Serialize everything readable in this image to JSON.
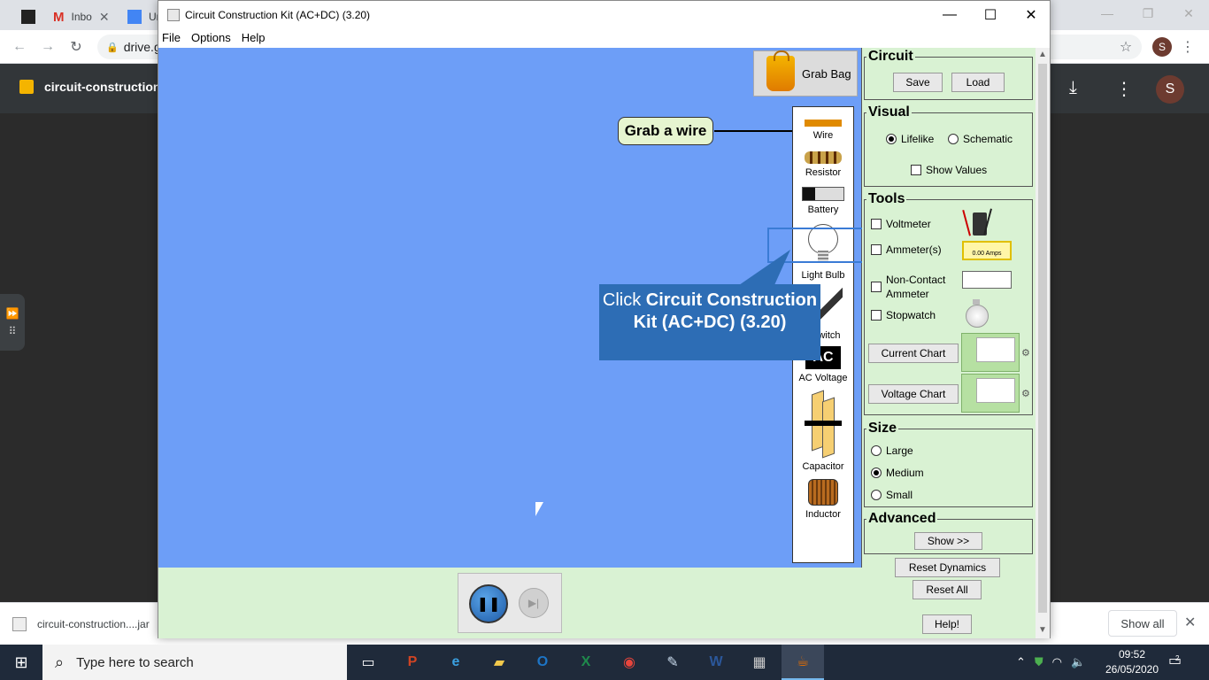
{
  "chrome": {
    "tabs": [
      {
        "label": "",
        "icon": "phet-icon"
      },
      {
        "label": "Inbo",
        "icon": "gmail-icon"
      },
      {
        "label": "Ur",
        "icon": "docs-icon"
      }
    ],
    "url": "drive.g",
    "profile_initial": "S",
    "drive_file_title": "circuit-construction",
    "drive_avatar": "S",
    "download_item": "circuit-construction....jar",
    "show_all": "Show all"
  },
  "app": {
    "title": "Circuit Construction Kit (AC+DC) (3.20)",
    "menu": [
      "File",
      "Options",
      "Help"
    ],
    "grab_bag": "Grab Bag",
    "grab_wire_label": "Grab a wire",
    "toolbox": {
      "wire": "Wire",
      "resistor": "Resistor",
      "battery": "Battery",
      "light_bulb": "Light Bulb",
      "switch": "witch",
      "ac_voltage": "AC Voltage",
      "capacitor": "Capacitor",
      "inductor": "Inductor"
    },
    "callout": {
      "prefix": "Click ",
      "bold": "Circuit Construction Kit (AC+DC) (3.20)"
    }
  },
  "panel": {
    "circuit": {
      "title": "Circuit",
      "save": "Save",
      "load": "Load"
    },
    "visual": {
      "title": "Visual",
      "lifelike": "Lifelike",
      "schematic": "Schematic",
      "show_values": "Show Values",
      "selected": "lifelike"
    },
    "tools": {
      "title": "Tools",
      "voltmeter": "Voltmeter",
      "ammeter": "Ammeter(s)",
      "non_contact_line1": "Non-Contact",
      "non_contact_line2": "Ammeter",
      "stopwatch": "Stopwatch",
      "current_chart": "Current Chart",
      "voltage_chart": "Voltage Chart",
      "ammeter_readout": "0.00 Amps"
    },
    "size": {
      "title": "Size",
      "large": "Large",
      "medium": "Medium",
      "small": "Small",
      "selected": "medium"
    },
    "advanced": {
      "title": "Advanced",
      "show": "Show >>"
    },
    "reset_dynamics": "Reset Dynamics",
    "reset_all": "Reset All",
    "help": "Help!"
  },
  "taskbar": {
    "search_placeholder": "Type here to search",
    "time": "09:52",
    "date": "26/05/2020",
    "notification_count": "2"
  }
}
